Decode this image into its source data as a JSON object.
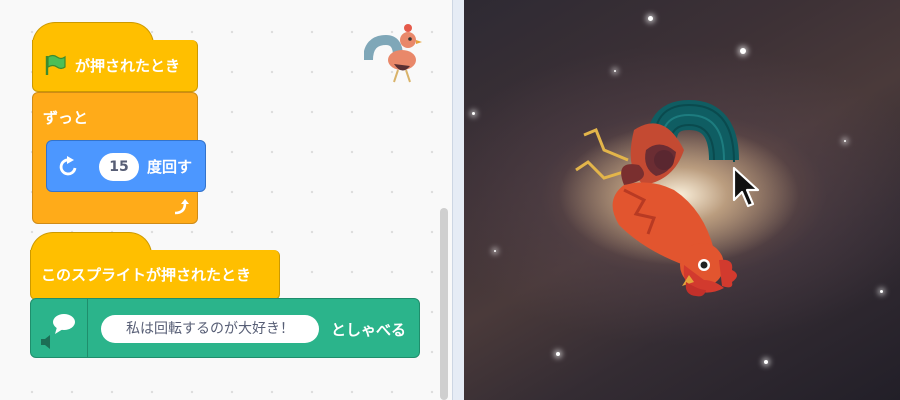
{
  "script1": {
    "when_flag_clicked": "が押されたとき",
    "forever": "ずっと",
    "turn_value": "15",
    "turn_label": "度回す"
  },
  "script2": {
    "when_sprite_clicked": "このスプライトが押されたとき",
    "say_text": "私は回転するのが大好き！",
    "say_label": "としゃべる"
  },
  "colors": {
    "events": "#ffbf00",
    "control": "#ffab19",
    "motion": "#4c97ff",
    "text_to_speech": "#2bb48b"
  },
  "icons": [
    "green-flag-icon",
    "turn-right-icon",
    "loop-arrow-icon",
    "speech-bubble-icon",
    "speaker-icon",
    "sprite-thumbnail-icon",
    "mouse-cursor-icon"
  ]
}
